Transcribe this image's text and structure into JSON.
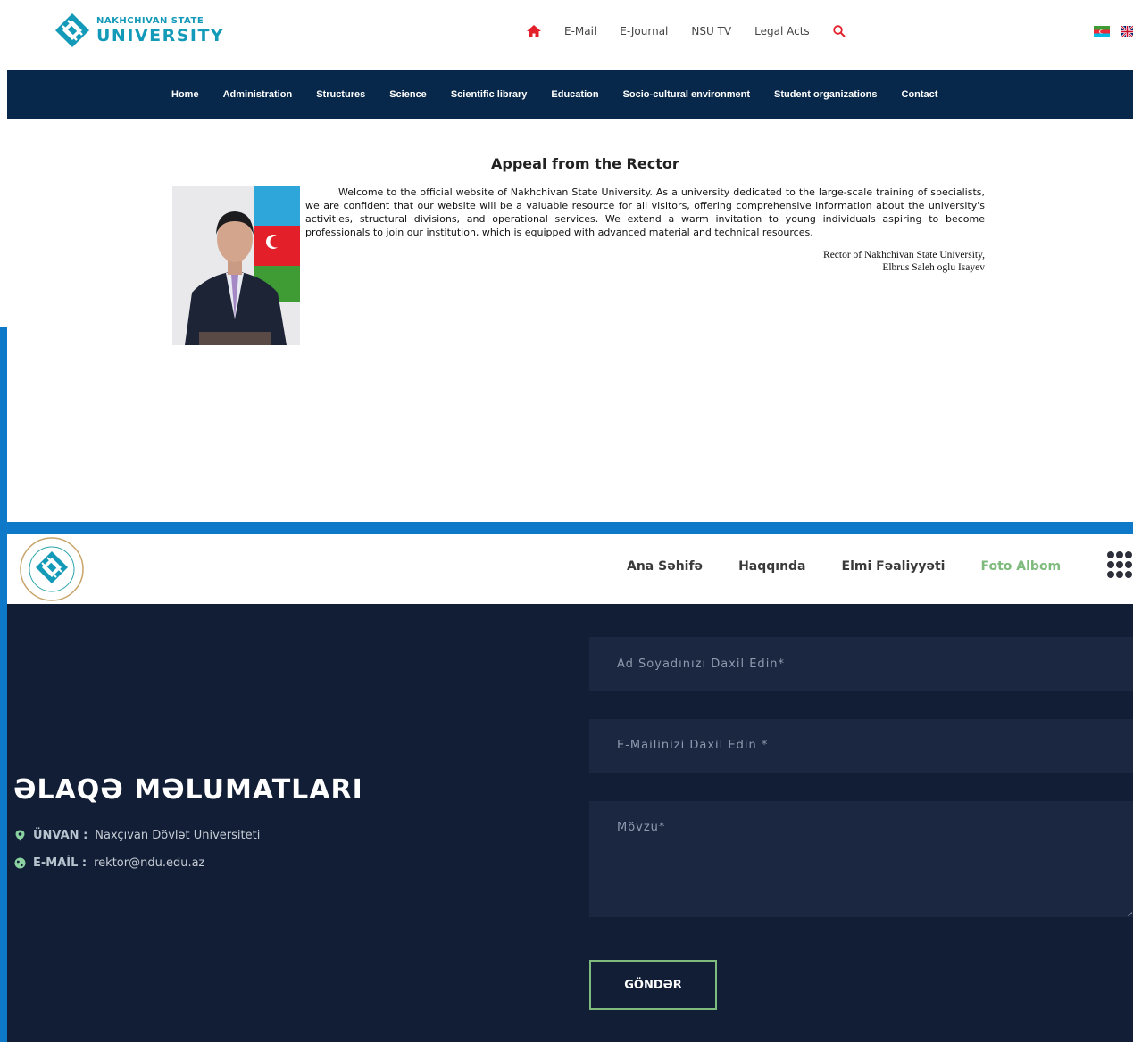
{
  "site1": {
    "logo": {
      "line1": "NAKHCHIVAN STATE",
      "line2": "UNIVERSITY"
    },
    "top_links": [
      "E-Mail",
      "E-Journal",
      "NSU TV",
      "Legal Acts"
    ],
    "icons": {
      "home": "home-icon",
      "search": "search-icon"
    },
    "flags": [
      "az-flag-icon",
      "uk-flag-icon"
    ],
    "nav": [
      "Home",
      "Administration",
      "Structures",
      "Science",
      "Scientific library",
      "Education",
      "Socio-cultural environment",
      "Student organizations",
      "Contact"
    ],
    "appeal": {
      "title": "Appeal from the Rector",
      "text": "Welcome to the official website of Nakhchivan State University. As a university dedicated to the large-scale training of specialists, we are confident that our website will be a valuable resource for all visitors, offering comprehensive information about the university's activities, structural divisions, and operational services. We extend a warm invitation to young individuals aspiring to become professionals to join our institution, which is equipped with advanced material and technical resources.",
      "signature_line1": "Rector of Nakhchivan State University,",
      "signature_line2": "Elbrus Saleh oglu Isayev"
    },
    "colors": {
      "brand": "#149ab9",
      "nav_bg": "#07284a",
      "accent": "#e3202a"
    }
  },
  "site2": {
    "menu": [
      "Ana Səhifə",
      "Haqqında",
      "Elmi Fəaliyyəti",
      "Foto Albom"
    ],
    "active_menu": "Foto Albom",
    "contact": {
      "title": "ƏLAQƏ MƏLUMATLARI",
      "address_label": "ÜNVAN :",
      "address_value": "Naxçıvan Dövlət Universiteti",
      "email_label": "E-MAİL :",
      "email_value": "rektor@ndu.edu.az"
    },
    "form": {
      "name_placeholder": "Ad Soyadınızı Daxil Edin*",
      "email_placeholder": "E-Mailinizi Daxil Edin *",
      "subject_placeholder": "Mövzu*",
      "submit_label": "GÖNDƏR"
    },
    "colors": {
      "bg": "#111e35",
      "field_bg": "#1b2740",
      "accent_green": "#7fbb7d",
      "frame_blue": "#0f79c9"
    }
  }
}
